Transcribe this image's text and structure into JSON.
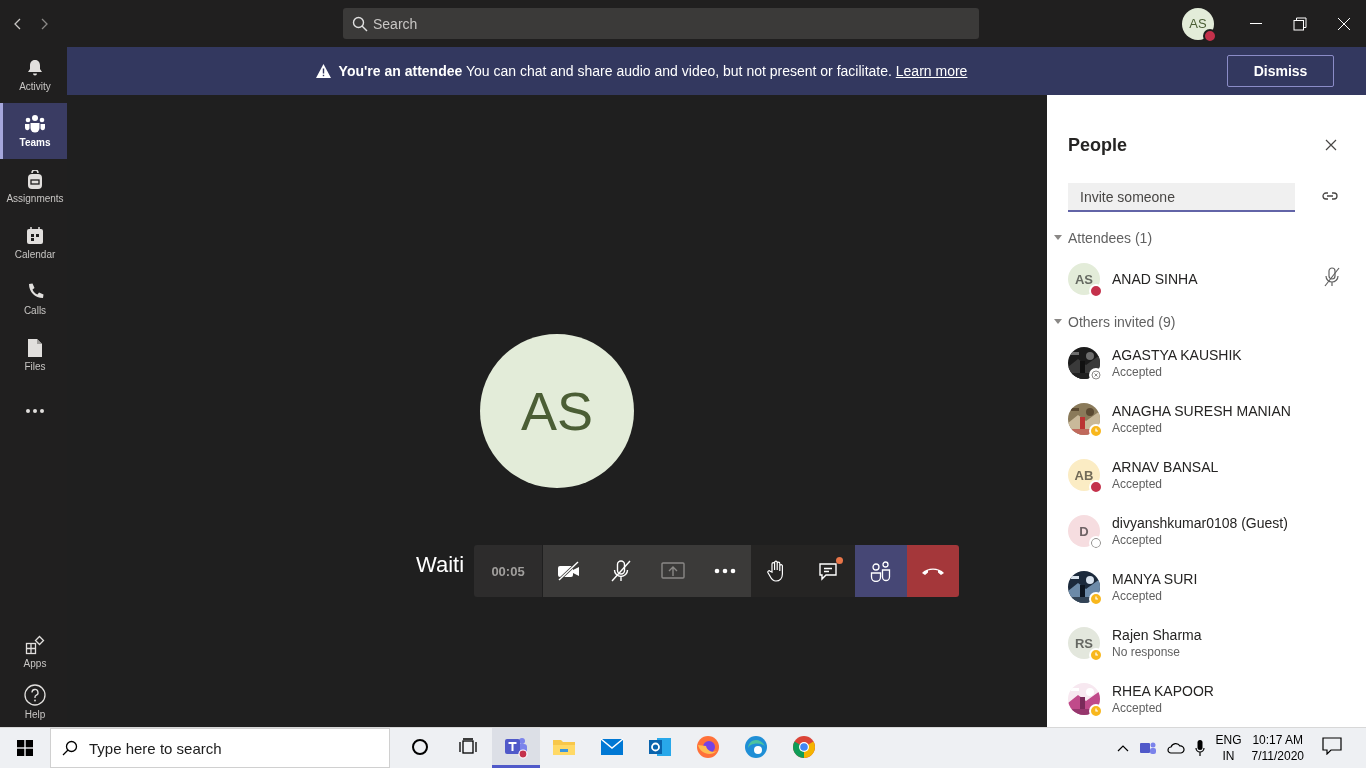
{
  "search": {
    "placeholder": "Search"
  },
  "account": {
    "initials": "AS",
    "badge": {
      "kind": "busy"
    }
  },
  "banner": {
    "text": "**You're an attendee** You can chat and share audio and video, but not present or facilitate.",
    "link": "Learn more",
    "button": "Dismiss"
  },
  "rail": [
    {
      "kind": "bell",
      "label": "Activity",
      "selected": false
    },
    {
      "kind": "teams",
      "label": "Teams",
      "selected": true
    },
    {
      "kind": "backpack",
      "label": "Assignments",
      "selected": false
    },
    {
      "kind": "calendar",
      "label": "Calendar",
      "selected": false
    },
    {
      "kind": "phone",
      "label": "Calls",
      "selected": false
    },
    {
      "kind": "file",
      "label": "Files",
      "selected": false
    },
    {
      "kind": "more",
      "selected": false
    }
  ],
  "rail_bottom": [
    {
      "kind": "apps",
      "label": "Apps",
      "selected": false
    },
    {
      "kind": "help",
      "label": "Help",
      "selected": false
    }
  ],
  "stage": {
    "initials": "AS",
    "message": "Waiti"
  },
  "call_controls": {
    "timer": "00:05",
    "buttons": [
      {
        "kind": "camera-off",
        "selected": false,
        "unread": false
      },
      {
        "kind": "mic-off",
        "selected": false,
        "unread": false
      },
      {
        "kind": "share",
        "selected": false,
        "unread": false
      },
      {
        "kind": "more",
        "selected": false,
        "unread": false
      },
      {
        "kind": "hand",
        "selected": false,
        "unread": false
      },
      {
        "kind": "chat",
        "selected": false,
        "unread": true
      },
      {
        "kind": "people",
        "selected": true,
        "unread": false
      },
      {
        "kind": "hangup",
        "selected": false,
        "unread": false
      }
    ]
  },
  "people": {
    "title": "People",
    "invite_placeholder": "Invite someone",
    "groups": [
      {
        "label": "Attendees (1)",
        "expanded": true,
        "members": [
          {
            "kind": "initials",
            "initials": "AS",
            "color": "#e3ecd9",
            "name": "ANAD SINHA",
            "badge": {
              "kind": "busy"
            },
            "muted": true
          }
        ]
      },
      {
        "label": "Others invited (9)",
        "expanded": true,
        "members": [
          {
            "kind": "picture",
            "name": "AGASTYA KAUSHIK",
            "response": "Accepted",
            "badge": {
              "kind": "offline"
            },
            "muted": false
          },
          {
            "kind": "picture",
            "name": "ANAGHA SURESH MANIAN",
            "response": "Accepted",
            "badge": {
              "kind": "away"
            },
            "muted": false
          },
          {
            "kind": "initials",
            "initials": "AB",
            "color": "#fbecc4",
            "name": "ARNAV BANSAL",
            "response": "Accepted",
            "badge": {
              "kind": "busy"
            },
            "muted": false
          },
          {
            "kind": "initials",
            "initials": "D",
            "color": "#f6dde0",
            "name": "divyanshkumar0108 (Guest)",
            "response": "Accepted",
            "badge": {
              "kind": "unknown"
            },
            "muted": false
          },
          {
            "kind": "picture",
            "name": "MANYA SURI",
            "response": "Accepted",
            "badge": {
              "kind": "away"
            },
            "muted": false
          },
          {
            "kind": "initials",
            "initials": "RS",
            "color": "#e3e7dd",
            "name": "Rajen Sharma",
            "response": "No response",
            "badge": {
              "kind": "away"
            },
            "muted": false
          },
          {
            "kind": "picture",
            "name": "RHEA KAPOOR",
            "response": "Accepted",
            "badge": {
              "kind": "away"
            },
            "muted": false
          }
        ]
      }
    ]
  },
  "taskbar": {
    "search_placeholder": "Type here to search",
    "apps": [
      {
        "kind": "cortana",
        "active": false
      },
      {
        "kind": "taskview",
        "active": false
      },
      {
        "kind": "teams",
        "active": true
      },
      {
        "kind": "explorer",
        "active": false
      },
      {
        "kind": "mail",
        "active": false
      },
      {
        "kind": "outlook",
        "active": false
      },
      {
        "kind": "firefox",
        "active": false
      },
      {
        "kind": "edge",
        "active": false
      },
      {
        "kind": "chrome",
        "active": false
      }
    ],
    "language": "ENG",
    "region": "IN",
    "time": "10:17 AM",
    "date": "7/11/2020"
  }
}
